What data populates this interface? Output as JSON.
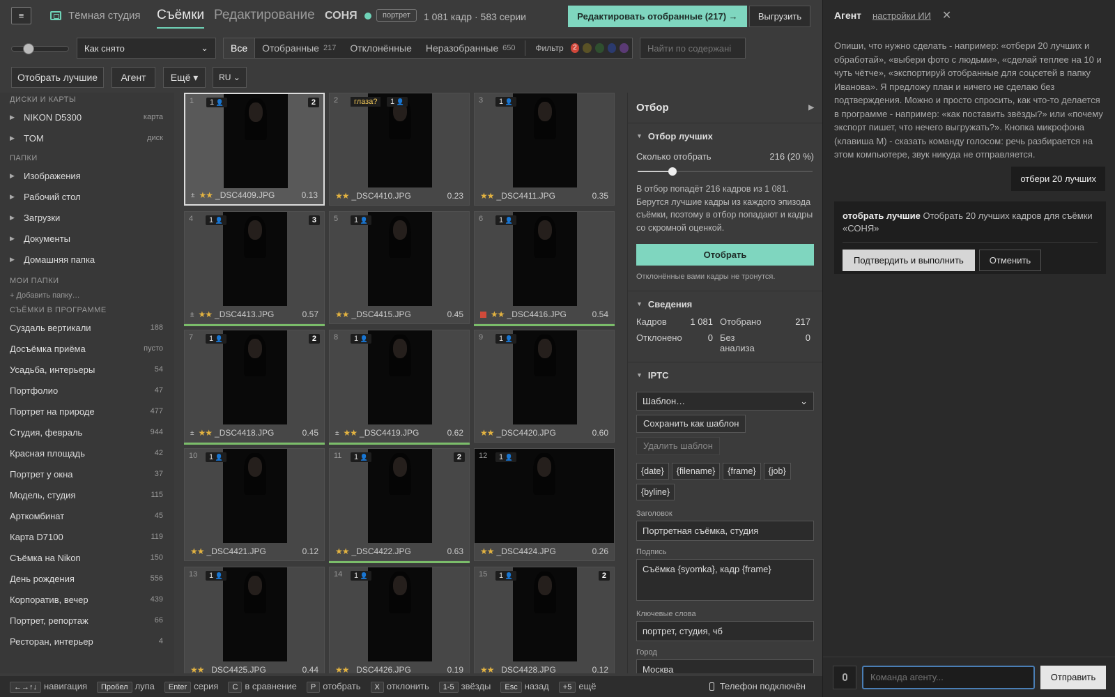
{
  "header": {
    "studio": "Тёмная студия",
    "tabs": [
      "Съёмки",
      "Редактирование"
    ],
    "shoot": "СОНЯ",
    "badge": "портрет",
    "counts": "1 081 кадр · 583 серии",
    "edit_btn": "Редактировать отобранные (217) →",
    "export_btn": "Выгрузить"
  },
  "toolbar": {
    "sort": "Как снято",
    "filters": [
      {
        "label": "Все",
        "count": ""
      },
      {
        "label": "Отобранные",
        "count": "217"
      },
      {
        "label": "Отклонённые",
        "count": ""
      },
      {
        "label": "Неразобранные",
        "count": "650"
      }
    ],
    "filter_label": "Фильтр",
    "filter_badge": "2",
    "colors": [
      "#d0473a",
      "#5a5226",
      "#2f4f2f",
      "#2b3a6e",
      "#5a3a74"
    ],
    "search_placeholder": "Найти по содержані",
    "btn_best": "Отобрать лучшие",
    "btn_agent": "Агент",
    "btn_more": "Ещё ▾",
    "lang": "RU"
  },
  "sidebar": {
    "h_disks": "ДИСКИ И КАРТЫ",
    "disks": [
      {
        "label": "NIKON D5300",
        "meta": "карта"
      },
      {
        "label": "TOM",
        "meta": "диск"
      }
    ],
    "h_folders": "ПАПКИ",
    "folders": [
      "Изображения",
      "Рабочий стол",
      "Загрузки",
      "Документы",
      "Домашняя папка"
    ],
    "h_my": "МОИ ПАПКИ",
    "add_folder": "+ Добавить папку…",
    "h_shoots": "СЪЁМКИ В ПРОГРАММЕ",
    "shoots": [
      {
        "label": "Суздаль вертикали",
        "count": "188"
      },
      {
        "label": "Досъёмка приёма",
        "count": "пусто"
      },
      {
        "label": "Усадьба, интерьеры",
        "count": "54"
      },
      {
        "label": "Портфолио",
        "count": "47"
      },
      {
        "label": "Портрет на природе",
        "count": "477"
      },
      {
        "label": "Студия, февраль",
        "count": "944"
      },
      {
        "label": "Красная площадь",
        "count": "42"
      },
      {
        "label": "Портрет у окна",
        "count": "37"
      },
      {
        "label": "Модель, студия",
        "count": "115"
      },
      {
        "label": "Арткомбинат",
        "count": "45"
      },
      {
        "label": "Карта D7100",
        "count": "119"
      },
      {
        "label": "Съёмка на Nikon",
        "count": "150"
      },
      {
        "label": "День рождения",
        "count": "556"
      },
      {
        "label": "Корпоратив, вечер",
        "count": "439"
      },
      {
        "label": "Портрет, репортаж",
        "count": "66"
      },
      {
        "label": "Ресторан, интерьер",
        "count": "4"
      }
    ]
  },
  "grid": [
    {
      "n": "1",
      "persons": "1",
      "group": "2",
      "tag": "",
      "file": "_DSC4409.JPG",
      "score": "0.13",
      "mark": "±",
      "picked": false,
      "rejected": false
    },
    {
      "n": "2",
      "persons": "1",
      "group": "",
      "tag": "глаза?",
      "file": "_DSC4410.JPG",
      "score": "0.23",
      "mark": "",
      "picked": false,
      "rejected": false
    },
    {
      "n": "3",
      "persons": "1",
      "group": "",
      "tag": "",
      "file": "_DSC4411.JPG",
      "score": "0.35",
      "mark": "",
      "picked": false,
      "rejected": false
    },
    {
      "n": "4",
      "persons": "1",
      "group": "3",
      "tag": "",
      "file": "_DSC4413.JPG",
      "score": "0.57",
      "mark": "±",
      "picked": true,
      "rejected": false
    },
    {
      "n": "5",
      "persons": "1",
      "group": "",
      "tag": "",
      "file": "_DSC4415.JPG",
      "score": "0.45",
      "mark": "",
      "picked": false,
      "rejected": false
    },
    {
      "n": "6",
      "persons": "1",
      "group": "",
      "tag": "",
      "file": "_DSC4416.JPG",
      "score": "0.54",
      "mark": "",
      "picked": true,
      "rejected": true
    },
    {
      "n": "7",
      "persons": "1",
      "group": "2",
      "tag": "",
      "file": "_DSC4418.JPG",
      "score": "0.45",
      "mark": "±",
      "picked": true,
      "rejected": false
    },
    {
      "n": "8",
      "persons": "1",
      "group": "",
      "tag": "",
      "file": "_DSC4419.JPG",
      "score": "0.62",
      "mark": "±",
      "picked": true,
      "rejected": false
    },
    {
      "n": "9",
      "persons": "1",
      "group": "",
      "tag": "",
      "file": "_DSC4420.JPG",
      "score": "0.60",
      "mark": "",
      "picked": false,
      "rejected": false
    },
    {
      "n": "10",
      "persons": "1",
      "group": "",
      "tag": "",
      "file": "_DSC4421.JPG",
      "score": "0.12",
      "mark": "",
      "picked": false,
      "rejected": false
    },
    {
      "n": "11",
      "persons": "1",
      "group": "2",
      "tag": "",
      "file": "_DSC4422.JPG",
      "score": "0.63",
      "mark": "",
      "picked": true,
      "rejected": false
    },
    {
      "n": "12",
      "persons": "1",
      "group": "",
      "tag": "",
      "file": "_DSC4424.JPG",
      "score": "0.26",
      "mark": "",
      "picked": false,
      "rejected": false
    },
    {
      "n": "13",
      "persons": "1",
      "group": "",
      "tag": "",
      "file": "_DSC4425.JPG",
      "score": "0.44",
      "mark": "",
      "picked": false,
      "rejected": false
    },
    {
      "n": "14",
      "persons": "1",
      "group": "",
      "tag": "",
      "file": "_DSC4426.JPG",
      "score": "0.19",
      "mark": "",
      "picked": false,
      "rejected": false
    },
    {
      "n": "15",
      "persons": "1",
      "group": "2",
      "tag": "",
      "file": "_DSC4428.JPG",
      "score": "0.12",
      "mark": "",
      "picked": false,
      "rejected": false
    }
  ],
  "panel": {
    "title": "Отбор",
    "best_title": "Отбор лучших",
    "how_many": "Сколько отобрать",
    "how_many_val": "216 (20 %)",
    "select_fraction": 0.2,
    "desc": "В отбор попадёт 216 кадров из 1 081. Берутся лучшие кадры из каждого эпизода съёмки, поэтому в отбор попадают и кадры со скромной оценкой.",
    "select_btn": "Отобрать",
    "note": "Отклонённые вами кадры не тронутся.",
    "info_title": "Сведения",
    "frames_l": "Кадров",
    "frames_v": "1 081",
    "picked_l": "Отобрано",
    "picked_v": "217",
    "rej_l": "Отклонено",
    "rej_v": "0",
    "noan_l": "Без анализа",
    "noan_v": "0",
    "iptc_title": "IPTC",
    "template": "Шаблон…",
    "save_tpl": "Сохранить как шаблон",
    "del_tpl": "Удалить шаблон",
    "chips": [
      "{date}",
      "{filename}",
      "{frame}",
      "{job}",
      "{byline}"
    ],
    "headline_l": "Заголовок",
    "headline_v": "Портретная съёмка, студия",
    "caption_l": "Подпись",
    "caption_v": "Съёмка {syomka}, кадр {frame}",
    "kw_l": "Ключевые слова",
    "kw_v": "портрет, студия, чб",
    "city_l": "Город",
    "city_v": "Москва"
  },
  "status": [
    {
      "k": "←→↑↓",
      "t": "навигация"
    },
    {
      "k": "Пробел",
      "t": "лупа"
    },
    {
      "k": "Enter",
      "t": "серия"
    },
    {
      "k": "C",
      "t": "в сравнение"
    },
    {
      "k": "P",
      "t": "отобрать"
    },
    {
      "k": "X",
      "t": "отклонить"
    },
    {
      "k": "1-5",
      "t": "звёзды"
    },
    {
      "k": "Esc",
      "t": "назад"
    },
    {
      "k": "+5",
      "t": "ещё"
    }
  ],
  "phone": "Телефон подключён",
  "agent": {
    "title": "Агент",
    "settings": "настройки ИИ",
    "intro": "Опиши, что нужно сделать - например: «отбери 20 лучших и обработай», «выбери фото с людьми», «сделай теплее на 10 и чуть чётче», «экспортируй отобранные для соцсетей в папку Иванова». Я предложу план и ничего не сделаю без подтверждения. Можно и просто спросить, как что-то делается в программе - например: «как поставить звёзды?» или «почему экспорт пишет, что нечего выгружать?». Кнопка микрофона (клавиша M) - сказать команду голосом: речь разбирается на этом компьютере, звук никуда не отправляется.",
    "user_msg": "отбери 20 лучших",
    "plan_bold": "отобрать лучшие",
    "plan_text": "Отобрать 20 лучших кадров для съёмки «СОНЯ»",
    "confirm": "Подтвердить и выполнить",
    "cancel": "Отменить",
    "input_placeholder": "Команда агенту...",
    "send": "Отправить"
  }
}
